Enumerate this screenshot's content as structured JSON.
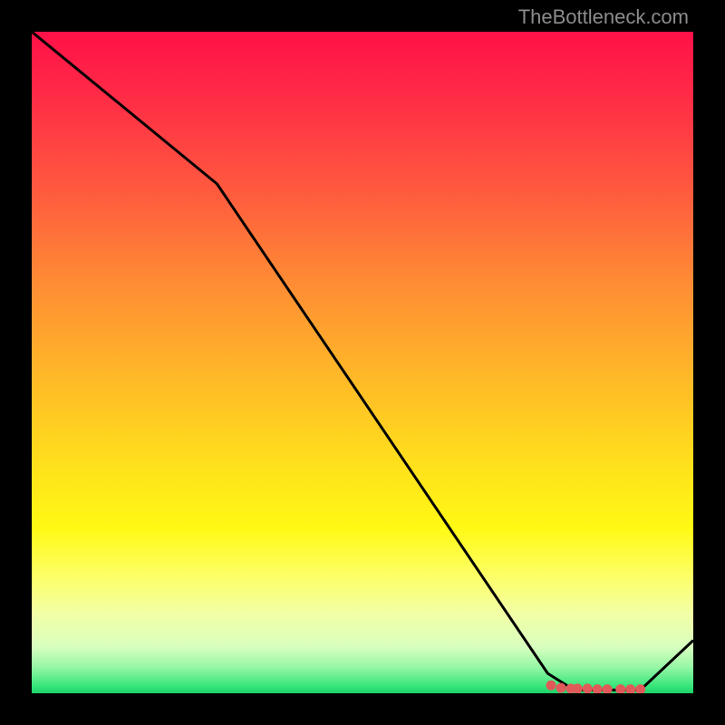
{
  "watermark": "TheBottleneck.com",
  "chart_data": {
    "type": "line",
    "title": "",
    "xlabel": "",
    "ylabel": "",
    "xlim": [
      0,
      100
    ],
    "ylim": [
      0,
      100
    ],
    "grid": false,
    "legend": false,
    "background": "rainbow-gradient-red-to-green",
    "x": [
      0,
      28,
      78,
      82,
      92,
      100
    ],
    "values": [
      100,
      77,
      3,
      0.5,
      0.5,
      8
    ],
    "line_color": "#000000",
    "markers": {
      "type": "circle",
      "color": "#e05a5a",
      "points": [
        {
          "x": 78.5,
          "y": 1.2
        },
        {
          "x": 80,
          "y": 0.8
        },
        {
          "x": 81.5,
          "y": 0.7
        },
        {
          "x": 82.5,
          "y": 0.7
        },
        {
          "x": 84,
          "y": 0.7
        },
        {
          "x": 85.5,
          "y": 0.6
        },
        {
          "x": 87,
          "y": 0.6
        },
        {
          "x": 89,
          "y": 0.6
        },
        {
          "x": 90.5,
          "y": 0.6
        },
        {
          "x": 92,
          "y": 0.6
        }
      ]
    }
  }
}
